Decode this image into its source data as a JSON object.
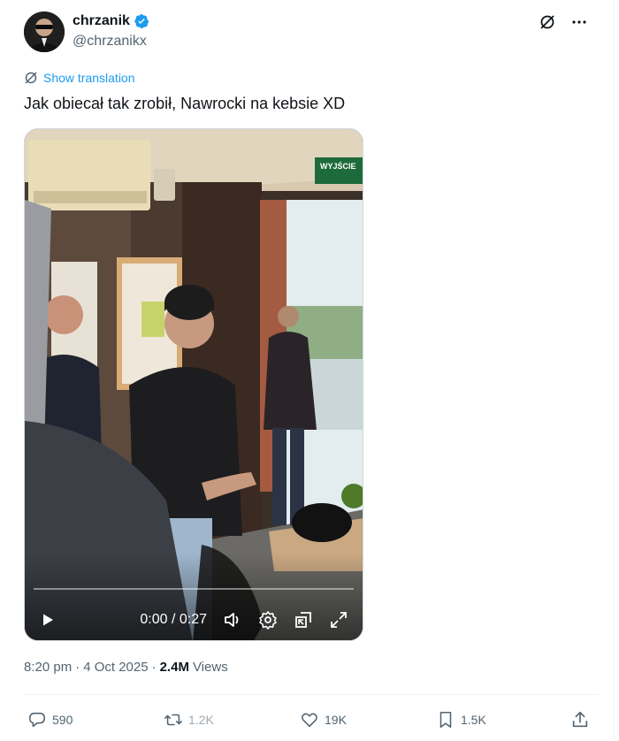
{
  "author": {
    "display_name": "chrzanik",
    "handle": "@chrzanikx",
    "verified": true
  },
  "translate_label": "Show translation",
  "tweet_text": "Jak obiecał tak zrobił, Nawrocki na kebsie XD",
  "video": {
    "time": "0:00 / 0:27",
    "progress": 0,
    "scene_sign_text": "WYJŚCIE"
  },
  "meta": {
    "time": "8:20 pm",
    "dot1": "·",
    "date": "4 Oct 2025",
    "dot2": "·",
    "views_count": "2.4M",
    "views_label": "Views"
  },
  "actions": {
    "replies": "590",
    "reposts": "1.2K",
    "likes": "19K",
    "bookmarks": "1.5K"
  },
  "colors": {
    "accent": "#1d9bf0",
    "text": "#0f1419",
    "secondary": "#536471"
  }
}
